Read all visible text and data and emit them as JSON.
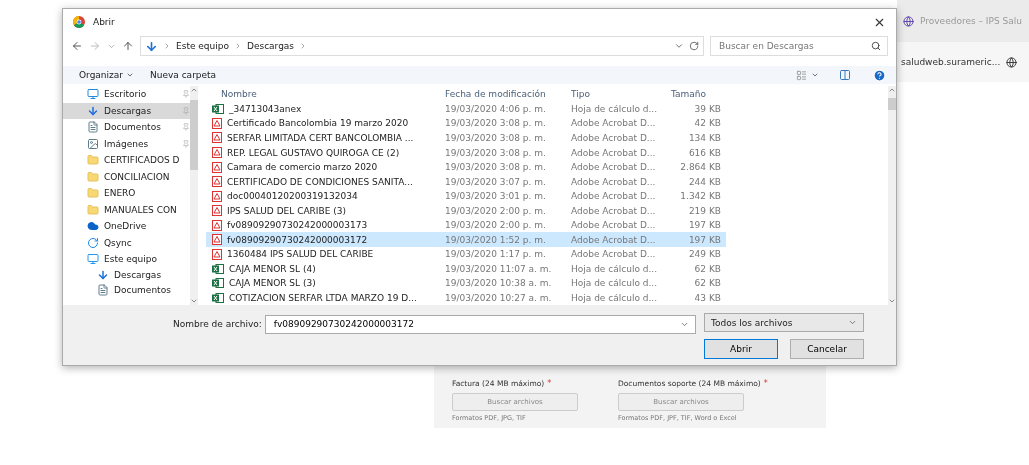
{
  "browser": {
    "tab_title": "Proveedores – IPS Salu",
    "address": "saludweb.surameric..."
  },
  "web_form": {
    "fields": [
      {
        "label": "Factura (24 MB máximo)",
        "required_mark": "*",
        "button": "Buscar archivos",
        "hint": "Formatos PDF, JPG, TIF"
      },
      {
        "label": "Documentos soporte (24 MB máximo)",
        "required_mark": "*",
        "button": "Buscar archivos",
        "hint": "Formatos PDF, JPF, TIF, Word o Excel"
      }
    ]
  },
  "dialog": {
    "title": "Abrir",
    "breadcrumb": [
      "Este equipo",
      "Descargas"
    ],
    "search": {
      "placeholder": "Buscar en Descargas"
    },
    "toolbar": [
      "Organizar",
      "Nueva carpeta"
    ],
    "nav": [
      {
        "label": "Escritorio",
        "kind": "desktop",
        "pinned": true,
        "selected": false
      },
      {
        "label": "Descargas",
        "kind": "download",
        "pinned": true,
        "selected": true
      },
      {
        "label": "Documentos",
        "kind": "documents",
        "pinned": true,
        "selected": false
      },
      {
        "label": "Imágenes",
        "kind": "pictures",
        "pinned": true,
        "selected": false
      },
      {
        "label": "CERTIFICADOS D",
        "kind": "folder",
        "pinned": false,
        "selected": false
      },
      {
        "label": "CONCILIACION",
        "kind": "folder",
        "pinned": false,
        "selected": false
      },
      {
        "label": "ENERO",
        "kind": "folder",
        "pinned": false,
        "selected": false
      },
      {
        "label": "MANUALES CON",
        "kind": "folder",
        "pinned": false,
        "selected": false
      },
      {
        "label": "OneDrive",
        "kind": "cloud",
        "pinned": false,
        "selected": false
      },
      {
        "label": "Qsync",
        "kind": "qsync",
        "pinned": false,
        "selected": false
      },
      {
        "label": "Este equipo",
        "kind": "computer",
        "pinned": false,
        "selected": false,
        "children": [
          {
            "label": "Descargas",
            "kind": "download",
            "pinned": false,
            "selected": false
          },
          {
            "label": "Documentos",
            "kind": "documents",
            "pinned": false,
            "selected": false
          }
        ]
      }
    ],
    "columns": [
      "Nombre",
      "Fecha de modificación",
      "Tipo",
      "Tamaño"
    ],
    "files": [
      {
        "name": "_34713043anex",
        "date": "19/03/2020 4:06 p. m.",
        "type": "Hoja de cálculo d...",
        "size": "39 KB",
        "kind": "excel",
        "selected": false
      },
      {
        "name": "Certificado Bancolombia 19 marzo 2020",
        "date": "19/03/2020 3:08 p. m.",
        "type": "Adobe Acrobat D...",
        "size": "42 KB",
        "kind": "pdf",
        "selected": false
      },
      {
        "name": "SERFAR LIMITADA CERT BANCOLOMBIA ...",
        "date": "19/03/2020 3:08 p. m.",
        "type": "Adobe Acrobat D...",
        "size": "134 KB",
        "kind": "pdf",
        "selected": false
      },
      {
        "name": "REP. LEGAL GUSTAVO QUIROGA CE (2)",
        "date": "19/03/2020 3:08 p. m.",
        "type": "Adobe Acrobat D...",
        "size": "616 KB",
        "kind": "pdf",
        "selected": false
      },
      {
        "name": "Camara de comercio marzo 2020",
        "date": "19/03/2020 3:08 p. m.",
        "type": "Adobe Acrobat D...",
        "size": "2.864 KB",
        "kind": "pdf",
        "selected": false
      },
      {
        "name": "CERTIFICADO DE CONDICIONES SANITA...",
        "date": "19/03/2020 3:07 p. m.",
        "type": "Adobe Acrobat D...",
        "size": "244 KB",
        "kind": "pdf",
        "selected": false
      },
      {
        "name": "doc00040120200319132034",
        "date": "19/03/2020 3:01 p. m.",
        "type": "Adobe Acrobat D...",
        "size": "1.342 KB",
        "kind": "pdf",
        "selected": false
      },
      {
        "name": "IPS SALUD DEL CARIBE (3)",
        "date": "19/03/2020 2:00 p. m.",
        "type": "Adobe Acrobat D...",
        "size": "219 KB",
        "kind": "pdf",
        "selected": false
      },
      {
        "name": "fv08909290730242000003173",
        "date": "19/03/2020 2:00 p. m.",
        "type": "Adobe Acrobat D...",
        "size": "197 KB",
        "kind": "pdf",
        "selected": false
      },
      {
        "name": "fv08909290730242000003172",
        "date": "19/03/2020 1:52 p. m.",
        "type": "Adobe Acrobat D...",
        "size": "197 KB",
        "kind": "pdf",
        "selected": true
      },
      {
        "name": "1360484 IPS SALUD DEL CARIBE",
        "date": "19/03/2020 1:17 p. m.",
        "type": "Adobe Acrobat D...",
        "size": "249 KB",
        "kind": "pdf",
        "selected": false
      },
      {
        "name": "CAJA MENOR SL (4)",
        "date": "19/03/2020 11:07 a. m.",
        "type": "Hoja de cálculo d...",
        "size": "62 KB",
        "kind": "excel",
        "selected": false
      },
      {
        "name": "CAJA MENOR SL (3)",
        "date": "19/03/2020 10:38 a. m.",
        "type": "Hoja de cálculo d...",
        "size": "62 KB",
        "kind": "excel",
        "selected": false
      },
      {
        "name": "COTIZACION SERFAR LTDA MARZO 19 D...",
        "date": "19/03/2020 10:27 a. m.",
        "type": "Hoja de cálculo d...",
        "size": "43 KB",
        "kind": "excel",
        "selected": false
      }
    ],
    "filename": {
      "label": "Nombre de archivo:",
      "value": "fv08909290730242000003172"
    },
    "filter": "Todos los archivos",
    "buttons": [
      {
        "label": "Abrir",
        "default": true
      },
      {
        "label": "Cancelar",
        "default": false
      }
    ]
  }
}
